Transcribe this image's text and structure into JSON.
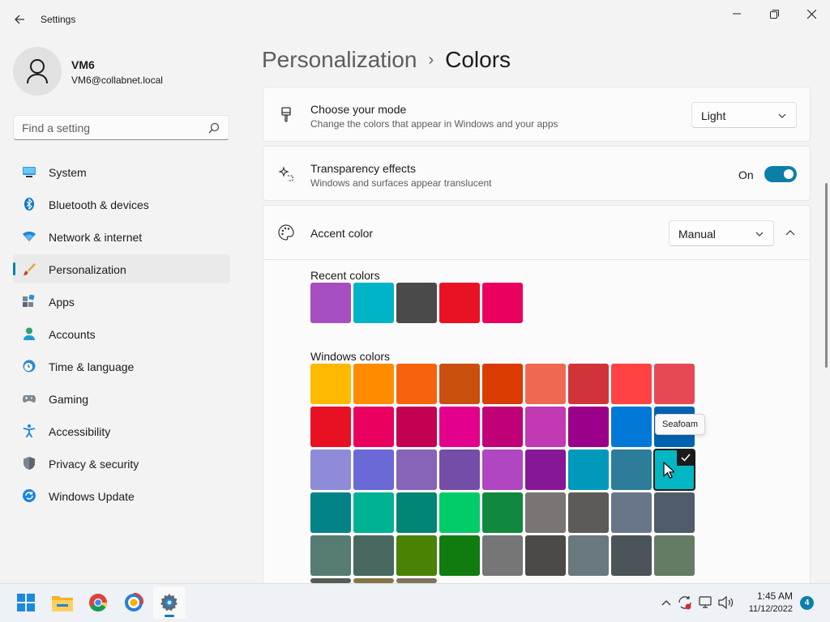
{
  "window": {
    "title": "Settings",
    "controls": [
      "minimize",
      "maximize",
      "close"
    ]
  },
  "profile": {
    "name": "VM6",
    "email": "VM6@collabnet.local"
  },
  "search": {
    "placeholder": "Find a setting"
  },
  "sidebar": {
    "items": [
      {
        "label": "System",
        "icon": "monitor-icon",
        "selected": false
      },
      {
        "label": "Bluetooth & devices",
        "icon": "bluetooth-icon",
        "selected": false
      },
      {
        "label": "Network & internet",
        "icon": "wifi-icon",
        "selected": false
      },
      {
        "label": "Personalization",
        "icon": "paintbrush-icon",
        "selected": true
      },
      {
        "label": "Apps",
        "icon": "apps-icon",
        "selected": false
      },
      {
        "label": "Accounts",
        "icon": "person-icon",
        "selected": false
      },
      {
        "label": "Time & language",
        "icon": "clock-globe-icon",
        "selected": false
      },
      {
        "label": "Gaming",
        "icon": "gamepad-icon",
        "selected": false
      },
      {
        "label": "Accessibility",
        "icon": "accessibility-icon",
        "selected": false
      },
      {
        "label": "Privacy & security",
        "icon": "shield-icon",
        "selected": false
      },
      {
        "label": "Windows Update",
        "icon": "update-icon",
        "selected": false
      }
    ]
  },
  "breadcrumb": {
    "parent": "Personalization",
    "separator": "›",
    "current": "Colors"
  },
  "mode": {
    "title": "Choose your mode",
    "description": "Change the colors that appear in Windows and your apps",
    "value": "Light"
  },
  "transparency": {
    "title": "Transparency effects",
    "description": "Windows and surfaces appear translucent",
    "state_label": "On",
    "enabled": true
  },
  "accent": {
    "title": "Accent color",
    "value": "Manual",
    "expanded": true,
    "recent_label": "Recent colors",
    "recent_colors": [
      "#a74fc0",
      "#00b4c7",
      "#4a4a4a",
      "#e81224",
      "#ea005e"
    ],
    "windows_label": "Windows colors",
    "windows_colors": [
      [
        "#ffb900",
        "#ff8c00",
        "#f7630c",
        "#ca5010",
        "#da3b01",
        "#ef6950",
        "#d13438",
        "#ff4343",
        "#e74856"
      ],
      [
        "#e81123",
        "#ea005e",
        "#c30052",
        "#e3008c",
        "#bf0077",
        "#c239b3",
        "#9a0089",
        "#0078d7",
        "#0063b1"
      ],
      [
        "#8e8cd8",
        "#6b69d6",
        "#8764b8",
        "#744da9",
        "#b146c2",
        "#881798",
        "#0099bc",
        "#2d7d9a",
        "#00b7c3"
      ],
      [
        "#038387",
        "#00b294",
        "#018574",
        "#00cc6a",
        "#10893e",
        "#7a7574",
        "#5d5a58",
        "#68768a",
        "#515c6b"
      ],
      [
        "#567c73",
        "#486860",
        "#498205",
        "#107c10",
        "#767676",
        "#4c4a48",
        "#69797e",
        "#4a5459",
        "#647c64"
      ],
      [
        "#525e54",
        "#847545",
        "#7e735f"
      ]
    ],
    "selected_row": 2,
    "selected_col": 8,
    "tooltip": "Seafoam"
  },
  "taskbar": {
    "apps": [
      "start-icon",
      "file-explorer-icon",
      "chrome-icon",
      "browser-icon",
      "settings-icon"
    ],
    "time": "1:45 AM",
    "date": "11/12/2022",
    "notification_count": "4"
  },
  "colors": {
    "accent": "#0b7fa8"
  }
}
